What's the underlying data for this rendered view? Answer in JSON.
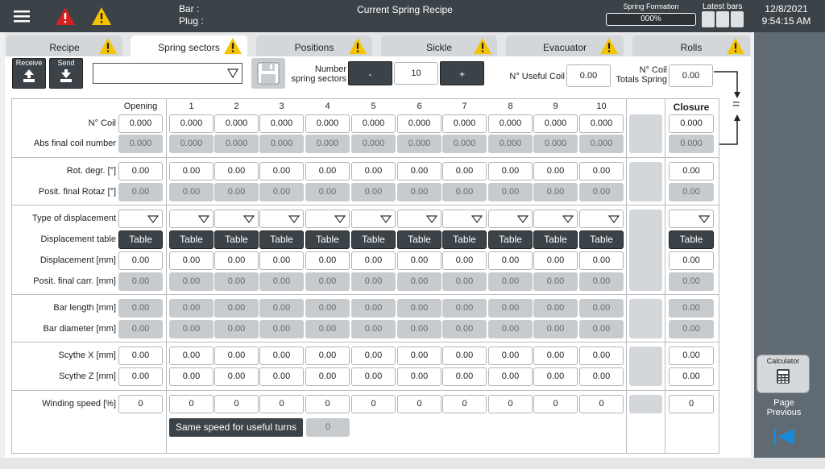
{
  "header": {
    "bar_label": "Bar :",
    "plug_label": "Plug :",
    "title": "Current Spring Recipe",
    "spring_formation_label": "Spring Formation",
    "spring_formation_value": "000%",
    "latest_bars_label": "Latest bars",
    "date": "12/8/2021",
    "time": "9:54:15 AM"
  },
  "tabs": [
    {
      "label": "Recipe",
      "active": false
    },
    {
      "label": "Spring sectors",
      "active": true
    },
    {
      "label": "Positions",
      "active": false
    },
    {
      "label": "Sickle",
      "active": false
    },
    {
      "label": "Evacuator",
      "active": false
    },
    {
      "label": "Rolls",
      "active": false
    }
  ],
  "toolbar": {
    "receive_label": "Receive",
    "send_label": "Send",
    "combo_value": "",
    "number_spring_sectors_label": "Number\nspring sectors",
    "minus_label": "-",
    "plus_label": "+",
    "spring_sectors_value": "10",
    "useful_coil_label": "N° Useful Coil",
    "useful_coil_value": "0.00",
    "coil_totals_label": "N° Coil\nTotals Spring",
    "coil_totals_value": "0.00",
    "equals_label": "="
  },
  "columns": [
    "Opening",
    "1",
    "2",
    "3",
    "4",
    "5",
    "6",
    "7",
    "8",
    "9",
    "10",
    "Closure"
  ],
  "rows": [
    {
      "label": "N° Coil",
      "value": "0.000",
      "type": "edit"
    },
    {
      "label": "Abs final coil number",
      "value": "0.000",
      "type": "ro"
    },
    {
      "label": "Rot. degr. [°]",
      "value": "0.00",
      "type": "edit"
    },
    {
      "label": "Posit. final Rotaz [°]",
      "value": "0.00",
      "type": "ro"
    },
    {
      "label": "Type of displacement",
      "value": "",
      "type": "dd"
    },
    {
      "label": "Displacement table",
      "value": "Table",
      "type": "tb"
    },
    {
      "label": "Displacement [mm]",
      "value": "0.00",
      "type": "edit"
    },
    {
      "label": "Posit. final carr. [mm]",
      "value": "0.00",
      "type": "ro"
    },
    {
      "label": "Bar length [mm]",
      "value": "0.00",
      "type": "ro"
    },
    {
      "label": "Bar diameter [mm]",
      "value": "0.00",
      "type": "ro"
    },
    {
      "label": "Scythe X [mm]",
      "value": "0.00",
      "type": "edit"
    },
    {
      "label": "Scythe Z [mm]",
      "value": "0.00",
      "type": "edit"
    },
    {
      "label": "Winding speed [%]",
      "value": "0",
      "type": "edit"
    }
  ],
  "same_speed_label": "Same speed for useful turns",
  "same_speed_value": "0",
  "sidebar": {
    "calculator_label": "Calculator",
    "page_previous_label": "Page\nPrevious"
  },
  "colors": {
    "dark": "#3c4348",
    "warning": "#f5c400",
    "alarm": "#d42020",
    "panel": "#5f6a72"
  }
}
